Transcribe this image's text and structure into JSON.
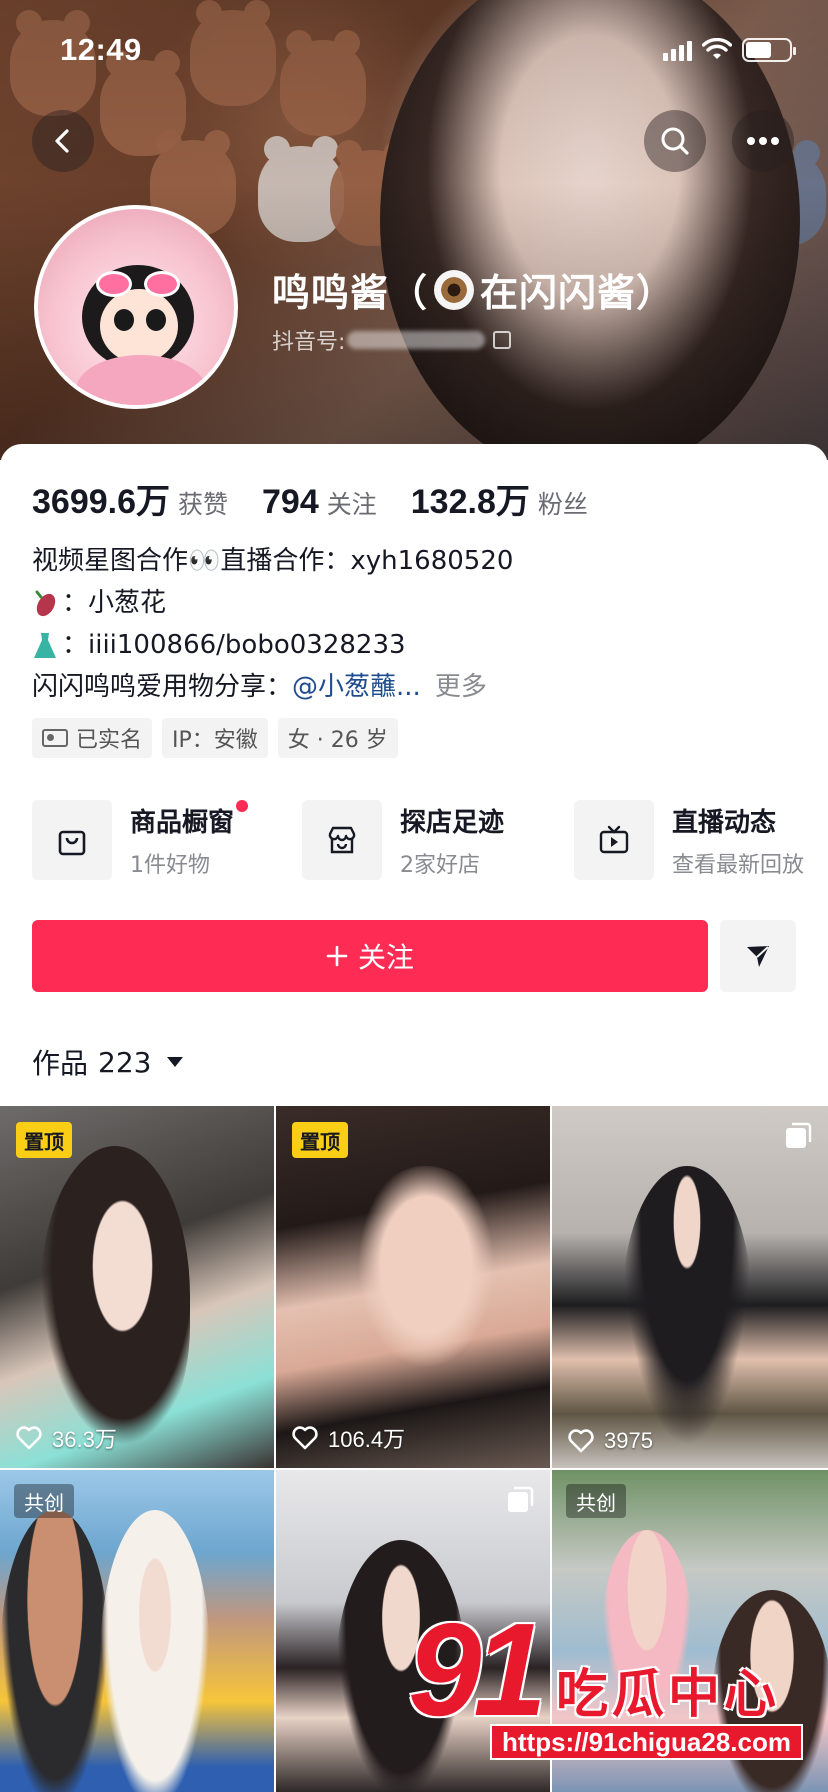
{
  "status_bar": {
    "time": "12:49"
  },
  "profile": {
    "nickname_prefix": "鸣鸣酱（",
    "nickname_suffix": "在闪闪酱）",
    "douyin_id_label": "抖音号:"
  },
  "stats": [
    {
      "value": "3699.6万",
      "label": "获赞"
    },
    {
      "value": "794",
      "label": "关注"
    },
    {
      "value": "132.8万",
      "label": "粉丝"
    }
  ],
  "bio": {
    "line1": "视频星图合作👀直播合作：xyh1680520",
    "line2": "：小葱花",
    "line3": "：iiii100866/bobo0328233",
    "line4_prefix": "闪闪鸣鸣爱用物分享：",
    "line4_mention": "@小葱蘸...",
    "more": "更多"
  },
  "tags": [
    {
      "label": "已实名"
    },
    {
      "label": "IP：安徽"
    },
    {
      "label": "女 · 26 岁"
    }
  ],
  "features": [
    {
      "title": "商品橱窗",
      "subtitle": "1件好物",
      "icon": "shopping-bag-icon"
    },
    {
      "title": "探店足迹",
      "subtitle": "2家好店",
      "icon": "store-icon"
    },
    {
      "title": "直播动态",
      "subtitle": "查看最新回放",
      "icon": "tv-icon"
    }
  ],
  "actions": {
    "follow_label": "关注"
  },
  "works": {
    "label": "作品",
    "count": "223"
  },
  "videos": [
    {
      "badge": "置顶",
      "likes": "36.3万"
    },
    {
      "badge": "置顶",
      "likes": "106.4万"
    },
    {
      "badge": "",
      "likes": "3975"
    },
    {
      "badge": "共创",
      "likes": ""
    },
    {
      "badge": "",
      "likes": ""
    },
    {
      "badge": "共创",
      "likes": ""
    }
  ],
  "watermark": {
    "number": "91",
    "text": "吃瓜中心",
    "url": "https://91chigua28.com"
  },
  "colors": {
    "accent": "#fe2c55",
    "pin_badge": "#face15",
    "mention": "#1f4b8f"
  }
}
